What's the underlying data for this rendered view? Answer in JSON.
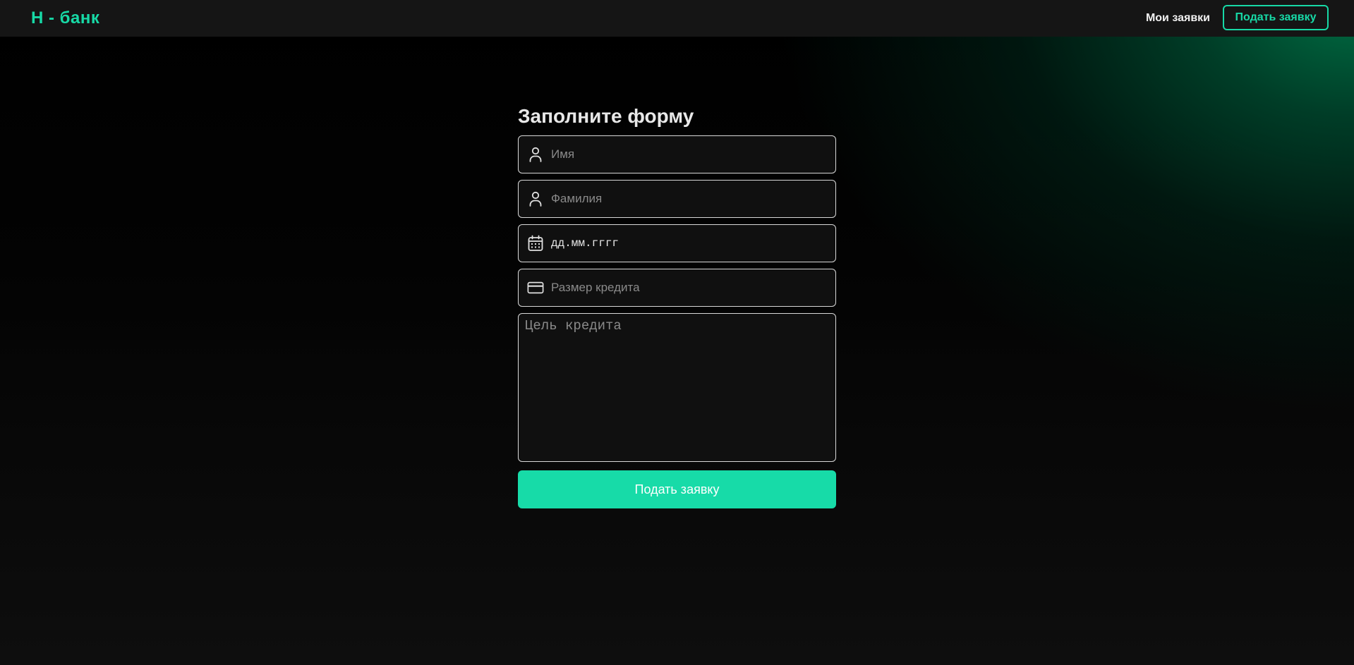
{
  "header": {
    "logo": "Н - банк",
    "nav_my_requests": "Мои заявки",
    "nav_submit": "Подать заявку"
  },
  "form": {
    "title": "Заполните форму",
    "first_name": {
      "placeholder": "Имя",
      "icon": "user-icon"
    },
    "last_name": {
      "placeholder": "Фамилия",
      "icon": "user-icon"
    },
    "birth_date": {
      "value": "дд.мм.гггг",
      "icon": "calendar-icon"
    },
    "credit_amount": {
      "placeholder": "Размер кредита",
      "icon": "credit-card-icon"
    },
    "credit_purpose": {
      "placeholder": "Цель кредита"
    },
    "submit_label": "Подать заявку"
  },
  "colors": {
    "accent": "#17d9a6",
    "header_bg": "#151515",
    "field_border": "#d8d8d8"
  }
}
